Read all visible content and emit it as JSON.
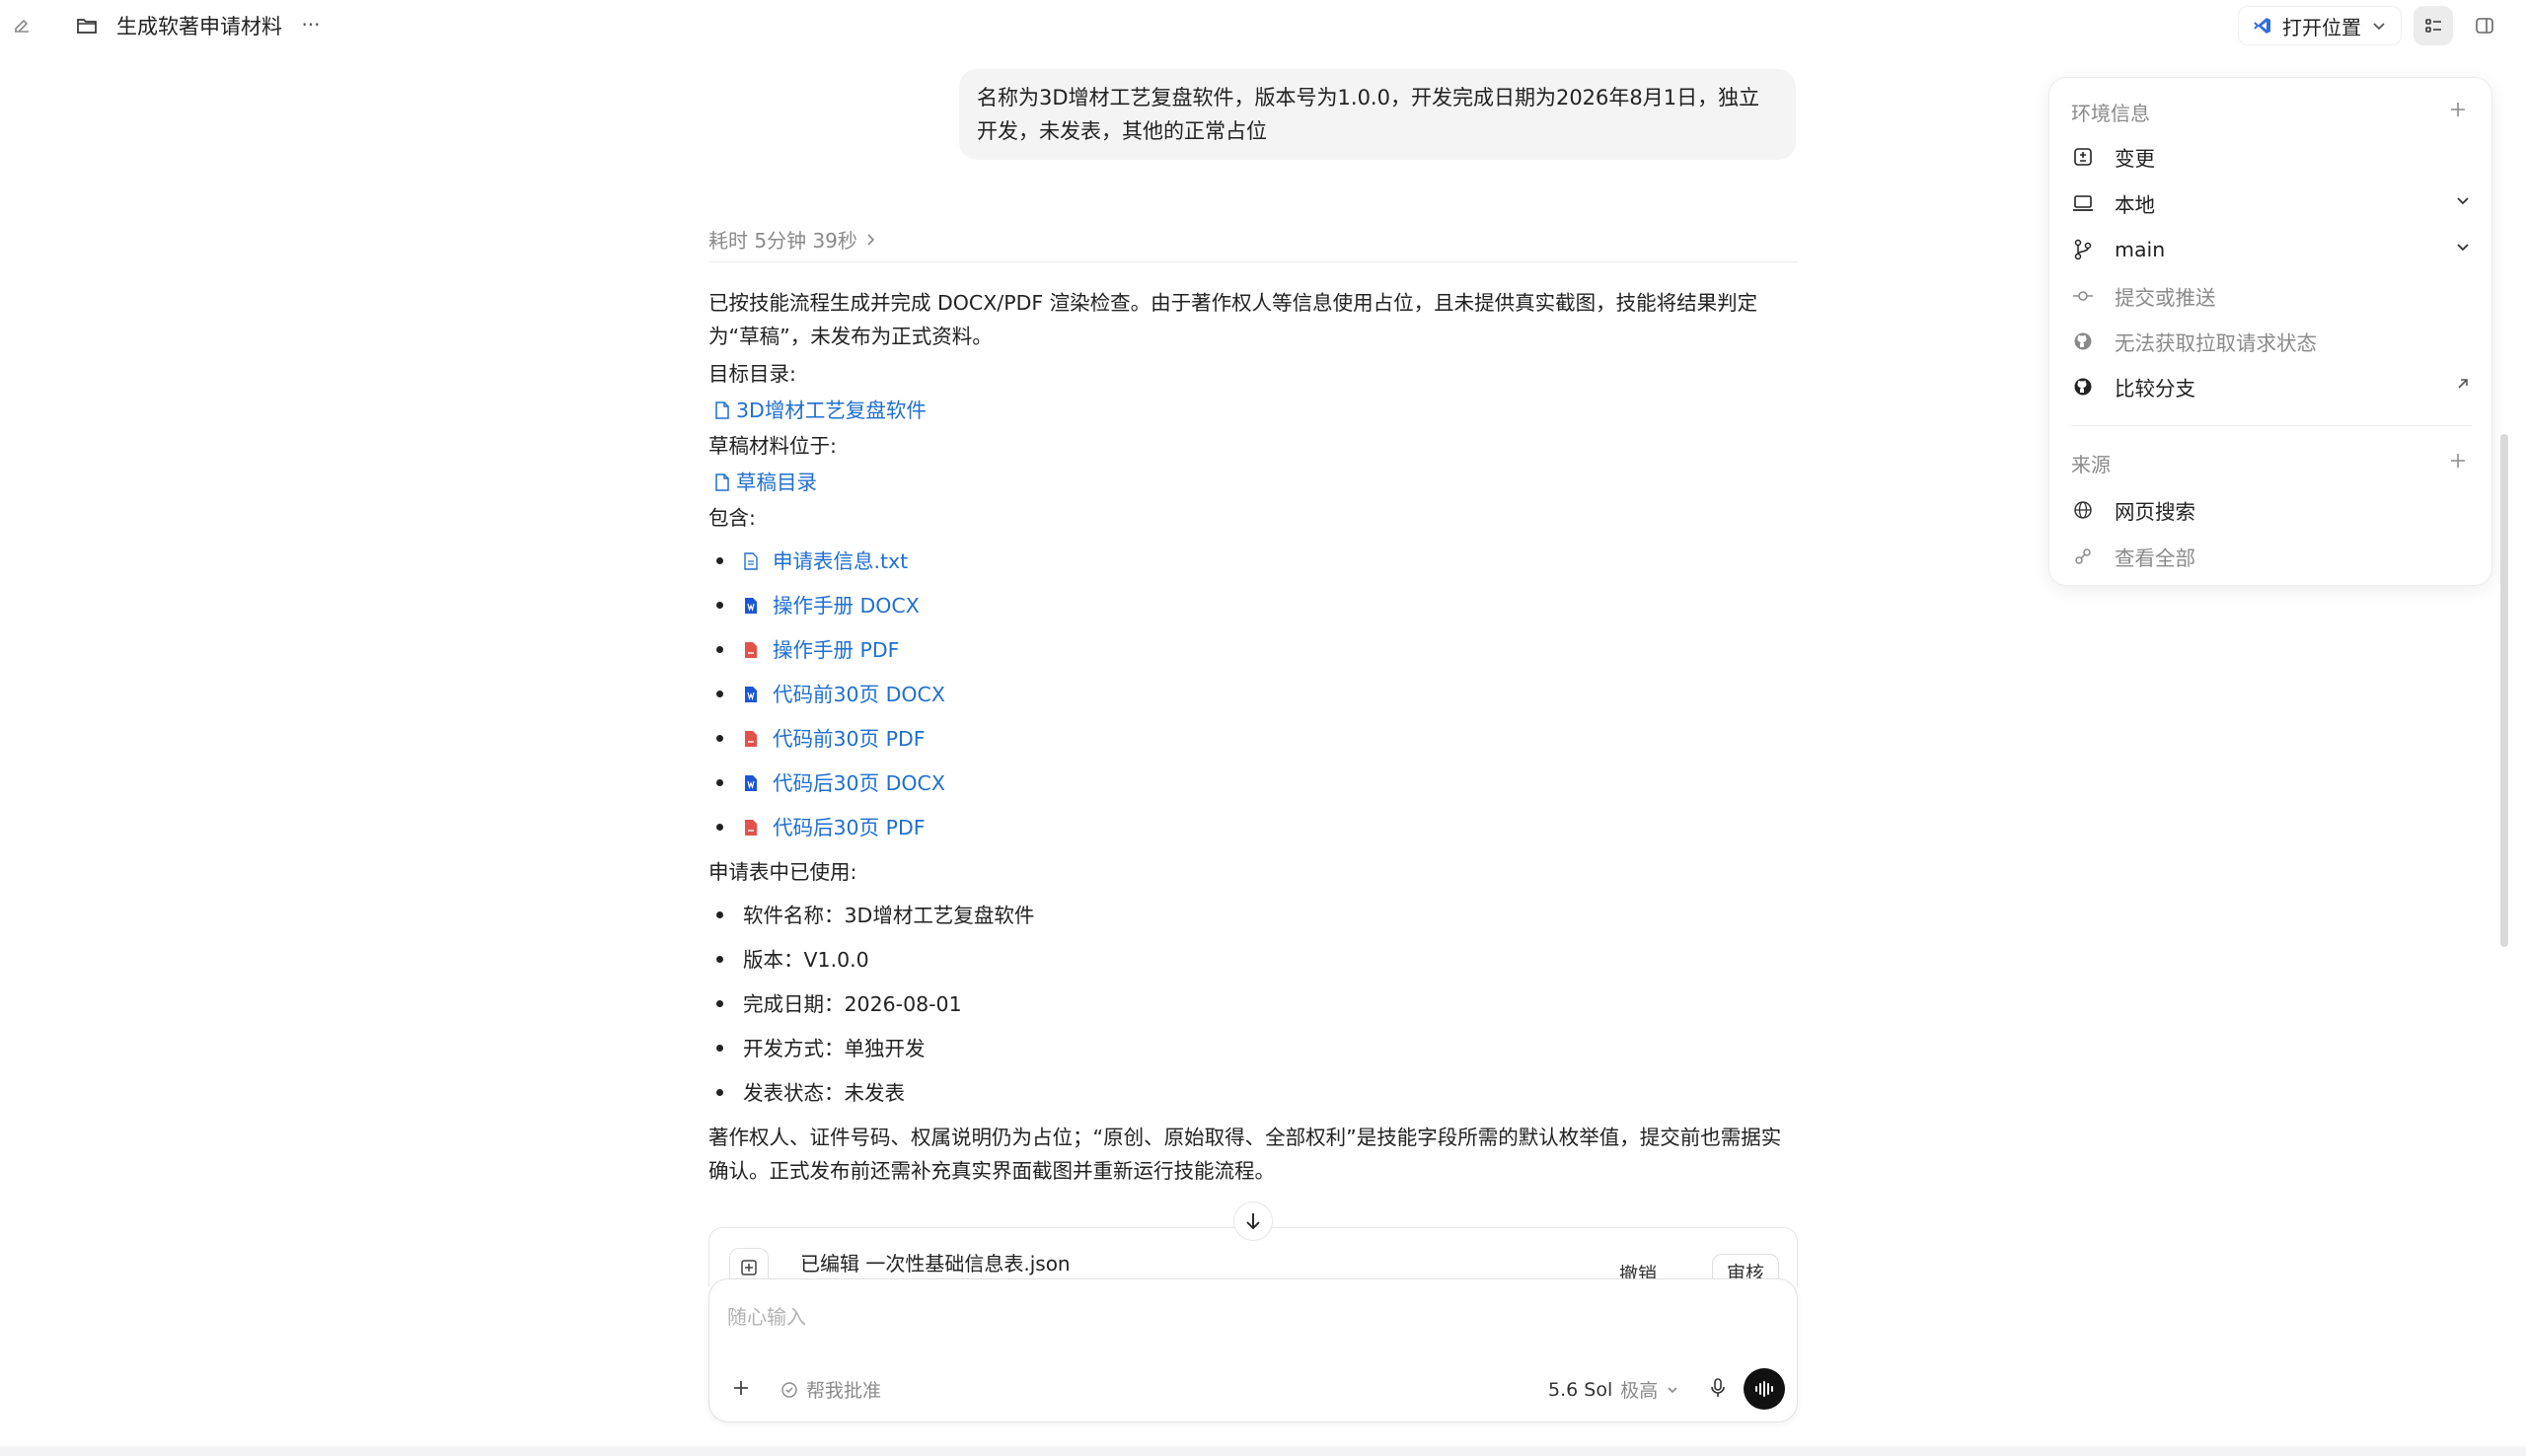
{
  "topbar": {
    "title": "生成软著申请材料",
    "more": "···",
    "open_location": "打开位置"
  },
  "user_message": "名称为3D增材工艺复盘软件，版本号为1.0.0，开发完成日期为2026年8月1日，独立开发，未发表，其他的正常占位",
  "duration": "耗时 5分钟 39秒",
  "response": {
    "para1": "已按技能流程生成并完成 DOCX/PDF 渲染检查。由于著作权人等信息使用占位，且未提供真实截图，技能将结果判定为“草稿”，未发布为正式资料。",
    "target_dir_label": "目标目录:",
    "target_dir_link": "3D增材工艺复盘软件",
    "draft_label": "草稿材料位于:",
    "draft_link": "草稿目录",
    "contains_label": "包含:",
    "files": [
      {
        "name": "申请表信息.txt",
        "type": "txt"
      },
      {
        "name": "操作手册 DOCX",
        "type": "docx"
      },
      {
        "name": "操作手册 PDF",
        "type": "pdf"
      },
      {
        "name": "代码前30页 DOCX",
        "type": "docx"
      },
      {
        "name": "代码前30页 PDF",
        "type": "pdf"
      },
      {
        "name": "代码后30页 DOCX",
        "type": "docx"
      },
      {
        "name": "代码后30页 PDF",
        "type": "pdf"
      }
    ],
    "used_label": "申请表中已使用:",
    "facts": [
      "软件名称：3D增材工艺复盘软件",
      "版本：V1.0.0",
      "完成日期：2026-08-01",
      "开发方式：单独开发",
      "发表状态：未发表"
    ],
    "para_last": "著作权人、证件号码、权属说明仍为占位；“原创、原始取得、全部权利”是技能字段所需的默认枚举值，提交前也需据实确认。正式发布前还需补充真实界面截图并重新运行技能流程。"
  },
  "edit_card": {
    "label": "已编辑 一次性基础信息表.json",
    "undo": "撤销",
    "review": "审核"
  },
  "composer": {
    "placeholder": "随心输入",
    "approve": "帮我批准",
    "model": "5.6 Sol",
    "effort": "极高"
  },
  "panel": {
    "env_title": "环境信息",
    "env_items": [
      {
        "label": "变更",
        "icon": "diff-icon",
        "muted": false
      },
      {
        "label": "本地",
        "icon": "laptop-icon",
        "muted": false
      },
      {
        "label": "main",
        "icon": "branch-icon",
        "muted": false
      },
      {
        "label": "提交或推送",
        "icon": "commit-icon",
        "muted": true
      },
      {
        "label": "无法获取拉取请求状态",
        "icon": "github-icon",
        "muted": true
      },
      {
        "label": "比较分支",
        "icon": "github-icon",
        "muted": false
      }
    ],
    "source_title": "来源",
    "source_items": [
      {
        "label": "网页搜索",
        "icon": "globe-icon",
        "muted": false
      },
      {
        "label": "查看全部",
        "icon": "link-icon",
        "muted": true
      }
    ]
  },
  "colors": {
    "link": "#1f6fd0",
    "docx": "#1a56d6",
    "pdf": "#e0524a",
    "open_location_icon": "#2f6fe0"
  }
}
